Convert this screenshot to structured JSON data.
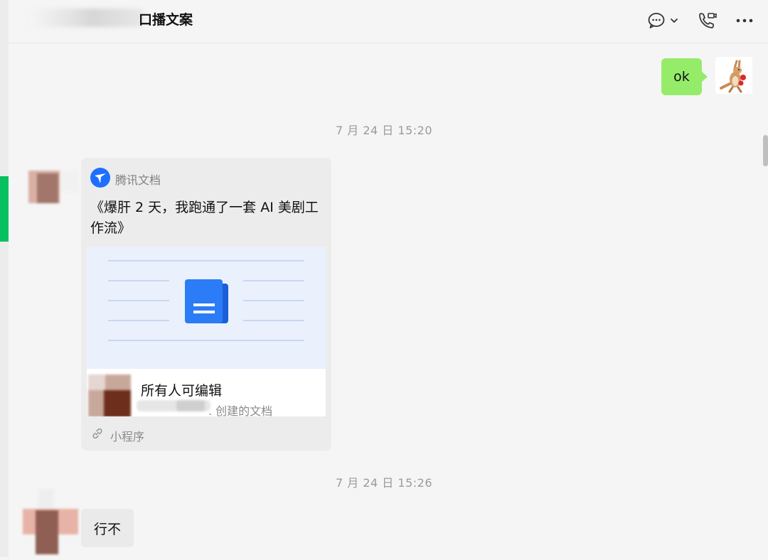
{
  "header": {
    "title": "口播文案",
    "icons": [
      "chat-bubble-icon",
      "chevron-down-icon",
      "video-call-icon",
      "more-icon"
    ]
  },
  "messages": {
    "mine_text": "ok",
    "timestamp_1": "7 月 24 日 15:20",
    "card": {
      "source": "腾讯文档",
      "title": "《爆肝 2 天，我跑通了一套 AI 美剧工作流》",
      "permission": "所有人可编辑",
      "creator_suffix": ". 创建的文档",
      "mini_program_label": "小程序"
    },
    "timestamp_2": "7 月 24 日 15:26",
    "other_text": "行不"
  },
  "colors": {
    "accent": "#07c160",
    "bubble_mine": "#95ec69",
    "doc_blue": "#2b7cf6"
  }
}
